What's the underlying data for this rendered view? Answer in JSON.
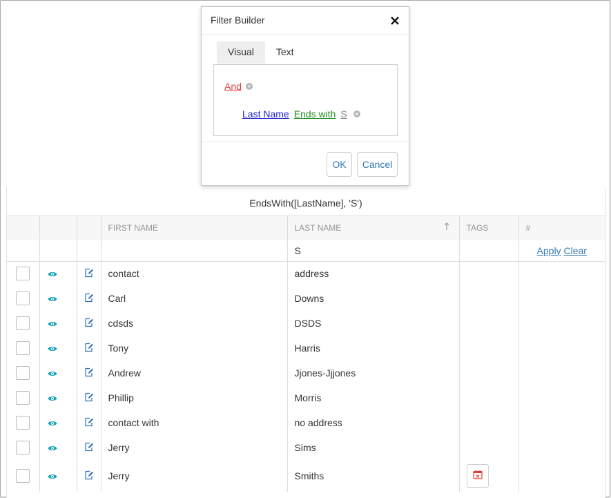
{
  "dialog": {
    "title": "Filter Builder",
    "tabs": [
      {
        "label": "Visual",
        "active": true
      },
      {
        "label": "Text",
        "active": false
      }
    ],
    "group_operator": "And",
    "condition": {
      "field": "Last Name",
      "operation": "Ends with",
      "value": "S"
    },
    "ok_label": "OK",
    "cancel_label": "Cancel"
  },
  "grid": {
    "filter_expression": "EndsWith([LastName], 'S')",
    "columns": [
      "",
      "",
      "",
      "FIRST NAME",
      "LAST NAME",
      "TAGS",
      "#"
    ],
    "sort": {
      "column": "LAST NAME",
      "direction": "ascending"
    },
    "filter_row": {
      "first_name": "",
      "last_name": "S",
      "apply_label": "Apply",
      "clear_label": "Clear"
    },
    "rows": [
      {
        "first_name": "contact",
        "last_name": "address"
      },
      {
        "first_name": "Carl",
        "last_name": "Downs"
      },
      {
        "first_name": "cdsds",
        "last_name": "DSDS"
      },
      {
        "first_name": "Tony",
        "last_name": "Harris"
      },
      {
        "first_name": "Andrew",
        "last_name": "Jjones-Jjjones"
      },
      {
        "first_name": "Phillip",
        "last_name": "Morris"
      },
      {
        "first_name": "contact with",
        "last_name": "no address"
      },
      {
        "first_name": "Jerry",
        "last_name": "Sims"
      },
      {
        "first_name": "Jerry",
        "last_name": "Smiths",
        "tag_icon": "calendar-icon"
      }
    ]
  },
  "colors": {
    "accent": "#337ab7",
    "eye_icon": "#17a2b8",
    "group_operator": "#e23a3a",
    "field": "#2222cc",
    "operation": "#1f8c1f",
    "value": "#888888",
    "tag_icon": "#e53935"
  }
}
